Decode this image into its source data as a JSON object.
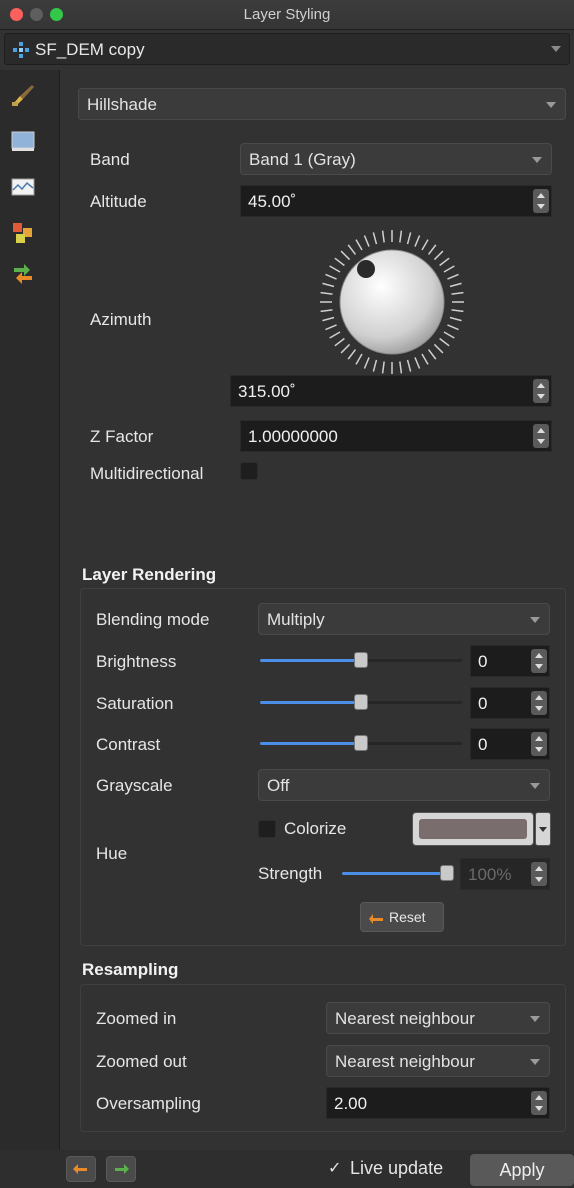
{
  "window": {
    "title": "Layer Styling"
  },
  "layer_selector": {
    "value": "SF_DEM copy"
  },
  "renderer": {
    "value": "Hillshade"
  },
  "hillshade": {
    "band_label": "Band",
    "band_value": "Band 1 (Gray)",
    "altitude_label": "Altitude",
    "altitude_value": "45.00˚",
    "azimuth_label": "Azimuth",
    "azimuth_value": "315.00˚",
    "zfactor_label": "Z Factor",
    "zfactor_value": "1.00000000",
    "multidirectional_label": "Multidirectional",
    "multidirectional_checked": false
  },
  "layer_rendering": {
    "title": "Layer Rendering",
    "blending_label": "Blending mode",
    "blending_value": "Multiply",
    "brightness_label": "Brightness",
    "brightness_value": "0",
    "brightness_level": 0.5,
    "saturation_label": "Saturation",
    "saturation_value": "0",
    "saturation_level": 0.5,
    "contrast_label": "Contrast",
    "contrast_value": "0",
    "contrast_level": 0.5,
    "grayscale_label": "Grayscale",
    "grayscale_value": "Off",
    "hue_label": "Hue",
    "colorize_label": "Colorize",
    "colorize_checked": false,
    "colorize_color": "#7a6d6d",
    "strength_label": "Strength",
    "strength_value": "100%",
    "strength_level": 1.0,
    "reset_label": "Reset"
  },
  "resampling": {
    "title": "Resampling",
    "zoomed_in_label": "Zoomed in",
    "zoomed_in_value": "Nearest neighbour",
    "zoomed_out_label": "Zoomed out",
    "zoomed_out_value": "Nearest neighbour",
    "oversampling_label": "Oversampling",
    "oversampling_value": "2.00"
  },
  "footer": {
    "live_update_label": "Live update",
    "live_update_checked": true,
    "apply_label": "Apply"
  },
  "icons": [
    "close-icon",
    "minimize-icon",
    "maximize-icon",
    "raster-layer-icon",
    "symbology-paintbrush-icon",
    "transparency-icon",
    "histogram-icon",
    "rendering-icon",
    "history-icon",
    "undo-icon",
    "redo-icon",
    "reset-icon"
  ],
  "colors": {
    "accent": "#4c8fe8",
    "background": "#323232",
    "field": "#1c1c1c"
  }
}
